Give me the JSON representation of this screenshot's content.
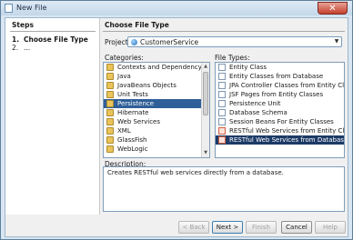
{
  "window": {
    "title": "New File",
    "close_glyph": "✕"
  },
  "steps": {
    "heading": "Steps",
    "items": [
      {
        "num": "1.",
        "label": "Choose File Type"
      },
      {
        "num": "2.",
        "label": "..."
      }
    ]
  },
  "main": {
    "heading": "Choose File Type",
    "project_label": "Project:",
    "project_value": "CustomerService",
    "categories_label": "Categories:",
    "file_types_label": "File Types:",
    "description_label": "Description:",
    "description_text": "Creates RESTful web services directly from a database."
  },
  "categories": [
    {
      "label": "Contexts and Dependency Injection",
      "icon": "folder-icon"
    },
    {
      "label": "Java",
      "icon": "folder-icon"
    },
    {
      "label": "JavaBeans Objects",
      "icon": "folder-icon"
    },
    {
      "label": "Unit Tests",
      "icon": "folder-icon"
    },
    {
      "label": "Persistence",
      "icon": "folder-icon"
    },
    {
      "label": "Hibernate",
      "icon": "folder-icon"
    },
    {
      "label": "Web Services",
      "icon": "folder-icon"
    },
    {
      "label": "XML",
      "icon": "folder-icon"
    },
    {
      "label": "GlassFish",
      "icon": "folder-icon"
    },
    {
      "label": "WebLogic",
      "icon": "folder-icon"
    }
  ],
  "file_types": [
    {
      "label": "Entity Class",
      "icon": "file-icon"
    },
    {
      "label": "Entity Classes from Database",
      "icon": "file-icon"
    },
    {
      "label": "JPA Controller Classes from Entity Classes",
      "icon": "file-icon"
    },
    {
      "label": "JSF Pages from Entity Classes",
      "icon": "file-icon"
    },
    {
      "label": "Persistence Unit",
      "icon": "file-icon"
    },
    {
      "label": "Database Schema",
      "icon": "file-icon"
    },
    {
      "label": "Session Beans For Entity Classes",
      "icon": "file-icon"
    },
    {
      "label": "RESTful Web Services from Entity Classes",
      "icon": "rest-icon"
    },
    {
      "label": "RESTful Web Services from Database",
      "icon": "rest-icon"
    }
  ],
  "buttons": {
    "back": "< Back",
    "next": "Next >",
    "finish": "Finish",
    "cancel": "Cancel",
    "help": "Help"
  },
  "colors": {
    "selection": "#2f5f98",
    "selection_strong": "#1c3a66"
  }
}
